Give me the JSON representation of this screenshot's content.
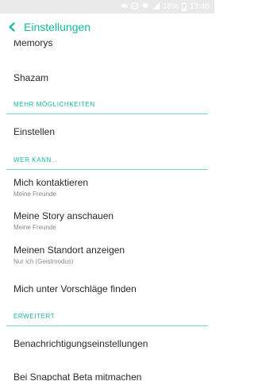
{
  "status_bar": {
    "battery_percent": "18%",
    "time": "13:48",
    "icons": [
      "mute-icon",
      "nfc-icon",
      "wifi-icon",
      "signal-icon",
      "battery-icon"
    ],
    "background_color": "#e9e9e9"
  },
  "header": {
    "title": "Einstellungen",
    "accent_color": "#14b8a0",
    "back_icon": "chevron-left-icon"
  },
  "list": {
    "top_items": [
      {
        "title": "Memorys"
      },
      {
        "title": "Shazam"
      }
    ],
    "sections": [
      {
        "header": "MEHR MÖGLICHKEITEN",
        "items": [
          {
            "title": "Einstellen"
          }
        ]
      },
      {
        "header": "WER KANN...",
        "items": [
          {
            "title": "Mich kontaktieren",
            "subtitle": "Meine Freunde"
          },
          {
            "title": "Meine Story anschauen",
            "subtitle": "Meine Freunde"
          },
          {
            "title": "Meinen Standort anzeigen",
            "subtitle": "Nur ich (Geistmodus)"
          },
          {
            "title": "Mich unter Vorschläge finden"
          }
        ]
      },
      {
        "header": "ERWEITERT",
        "items": [
          {
            "title": "Benachrichtigungseinstellungen"
          },
          {
            "title": "Bei Snapchat Beta mitmachen"
          }
        ]
      }
    ]
  }
}
